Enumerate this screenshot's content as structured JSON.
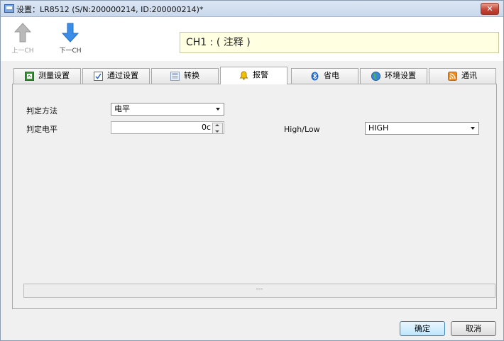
{
  "window": {
    "title": "设置：LR8512 (S/N:200000214, ID:200000214)*",
    "close_label": "✕"
  },
  "toolbar": {
    "prev_label": "上一CH",
    "next_label": "下一CH",
    "comment": "CH1 : ( 注释 )"
  },
  "tabs": [
    {
      "label": "测量设置",
      "icon": "measure-icon"
    },
    {
      "label": "通过设置",
      "icon": "checkbox-icon"
    },
    {
      "label": "转换",
      "icon": "calculator-icon"
    },
    {
      "label": "报警",
      "icon": "bell-icon",
      "active": true
    },
    {
      "label": "省电",
      "icon": "bluetooth-icon"
    },
    {
      "label": "环境设置",
      "icon": "globe-icon"
    },
    {
      "label": "通讯",
      "icon": "rss-icon"
    }
  ],
  "form": {
    "method_label": "判定方法",
    "method_value": "电平",
    "level_label": "判定电平",
    "level_value": "0c",
    "highlow_label": "High/Low",
    "highlow_value": "HIGH"
  },
  "status_text": "---",
  "buttons": {
    "ok": "确定",
    "cancel": "取消"
  },
  "colors": {
    "accent": "#3b8ee8",
    "comment_bg": "#ffffe1",
    "close": "#c6463a"
  }
}
